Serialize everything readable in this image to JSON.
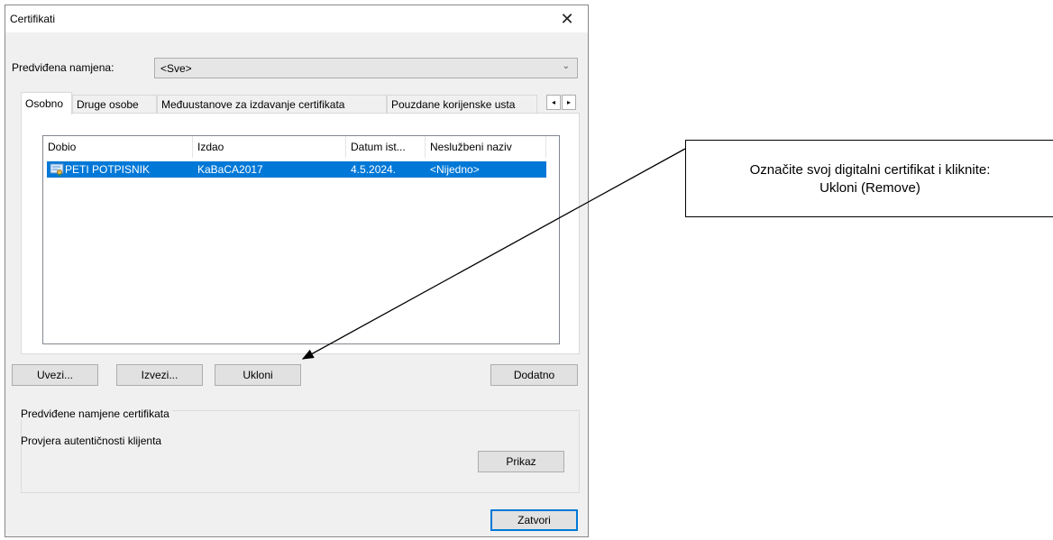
{
  "dialog": {
    "title": "Certifikati",
    "close_glyph": "✕"
  },
  "purpose": {
    "label": "Predviđena namjena:",
    "value": "<Sve>"
  },
  "tabs": [
    {
      "label": "Osobno",
      "active": true
    },
    {
      "label": "Druge osobe",
      "active": false
    },
    {
      "label": "Međuustanove za izdavanje certifikata",
      "active": false
    },
    {
      "label": "Pouzdane korijenske usta",
      "active": false
    }
  ],
  "tab_scroll": {
    "left": "◂",
    "right": "▸"
  },
  "list": {
    "columns": [
      "Dobio",
      "Izdao",
      "Datum ist...",
      "Neslužbeni naziv"
    ],
    "rows": [
      {
        "issued_to": "PETI POTPISNIK",
        "issued_by": "KaBaCA2017",
        "expiry": "4.5.2024.",
        "friendly_name": "<Nijedno>",
        "selected": true,
        "icon": "certificate-icon"
      }
    ]
  },
  "buttons": {
    "import": "Uvezi...",
    "export": "Izvezi...",
    "remove": "Ukloni",
    "advanced": "Dodatno",
    "view": "Prikaz",
    "close": "Zatvori"
  },
  "purposes_group": {
    "title": "Predviđene namjene certifikata",
    "text": "Provjera autentičnosti klijenta"
  },
  "annotation": {
    "line1": "Označite svoj digitalni certifikat i kliknite:",
    "line2": "Ukloni (Remove)"
  },
  "colors": {
    "selection": "#0078d7",
    "dialog_bg": "#f0f0f0",
    "button_bg": "#e1e1e1"
  }
}
